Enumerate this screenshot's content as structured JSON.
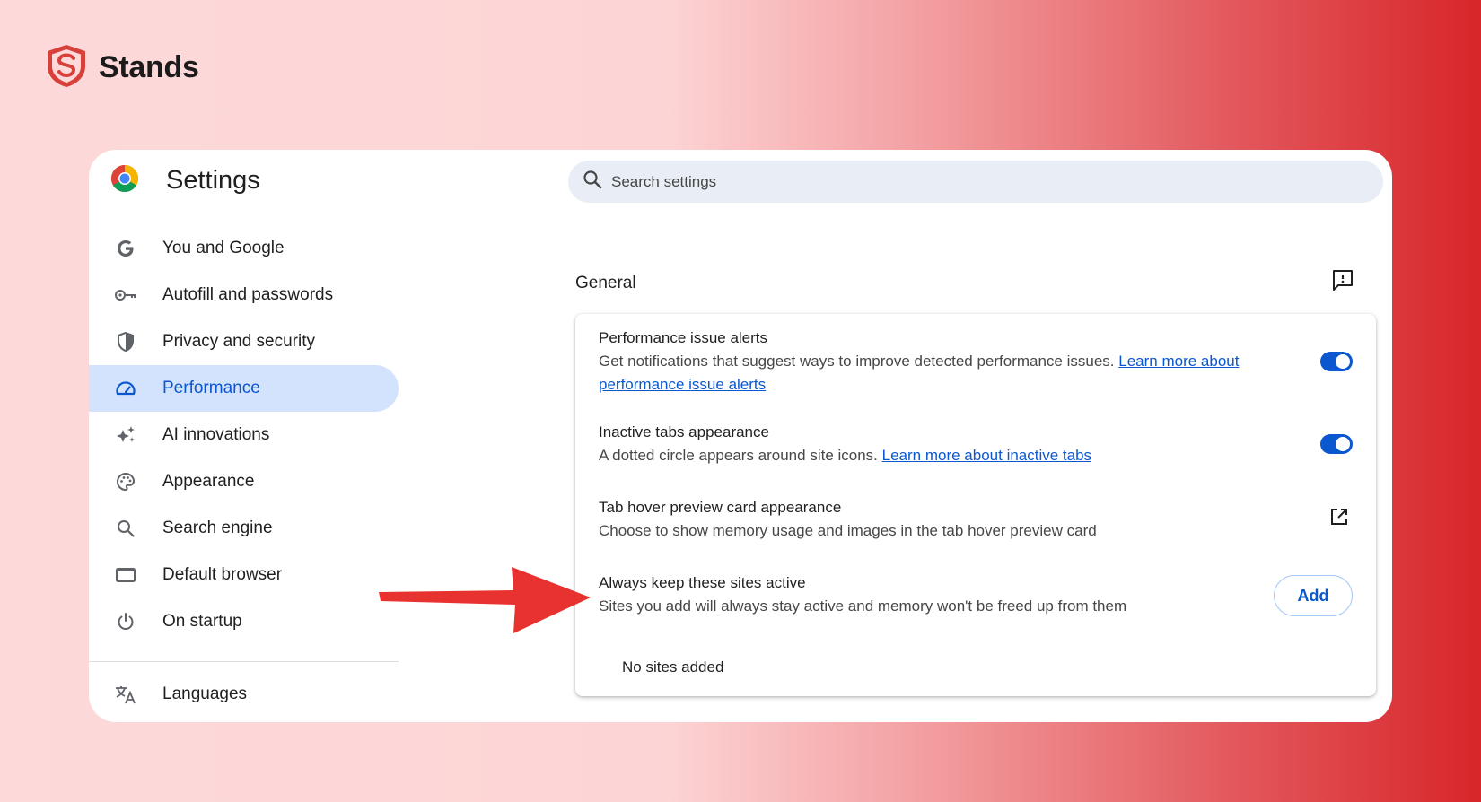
{
  "brand": {
    "name": "Stands",
    "logo_icon": "stands-shield-logo",
    "color": "#d8413a"
  },
  "window": {
    "title": "Settings",
    "logo_icon": "chrome-logo",
    "search": {
      "placeholder": "Search settings",
      "value": ""
    }
  },
  "sidebar": {
    "items": [
      {
        "label": "You and Google",
        "icon": "google-g-icon",
        "active": false
      },
      {
        "label": "Autofill and passwords",
        "icon": "key-icon",
        "active": false
      },
      {
        "label": "Privacy and security",
        "icon": "shield-icon",
        "active": false
      },
      {
        "label": "Performance",
        "icon": "speedometer-icon",
        "active": true
      },
      {
        "label": "AI innovations",
        "icon": "sparkle-icon",
        "active": false
      },
      {
        "label": "Appearance",
        "icon": "palette-icon",
        "active": false
      },
      {
        "label": "Search engine",
        "icon": "search-icon",
        "active": false
      },
      {
        "label": "Default browser",
        "icon": "browser-window-icon",
        "active": false
      },
      {
        "label": "On startup",
        "icon": "power-icon",
        "active": false
      },
      {
        "label": "Languages",
        "icon": "translate-icon",
        "active": false
      }
    ]
  },
  "main": {
    "section_title": "General",
    "feedback_icon": "feedback-icon",
    "settings": [
      {
        "title": "Performance issue alerts",
        "description": "Get notifications that suggest ways to improve detected performance issues.",
        "link_text": "Learn more about performance issue alerts",
        "control": "toggle",
        "enabled": true
      },
      {
        "title": "Inactive tabs appearance",
        "description": "A dotted circle appears around site icons.",
        "link_text": "Learn more about inactive tabs",
        "control": "toggle",
        "enabled": true
      },
      {
        "title": "Tab hover preview card appearance",
        "description": "Choose to show memory usage and images in the tab hover preview card",
        "control": "external-link-icon"
      },
      {
        "title": "Always keep these sites active",
        "description": "Sites you add will always stay active and memory won't be freed up from them",
        "control": "button",
        "button_label": "Add"
      }
    ],
    "empty_state": "No sites added"
  },
  "annotation": {
    "icon": "red-arrow-pointer",
    "color": "#e8322f"
  },
  "colors": {
    "accent": "#0b57d0",
    "active_nav_bg": "#d3e3fd"
  }
}
